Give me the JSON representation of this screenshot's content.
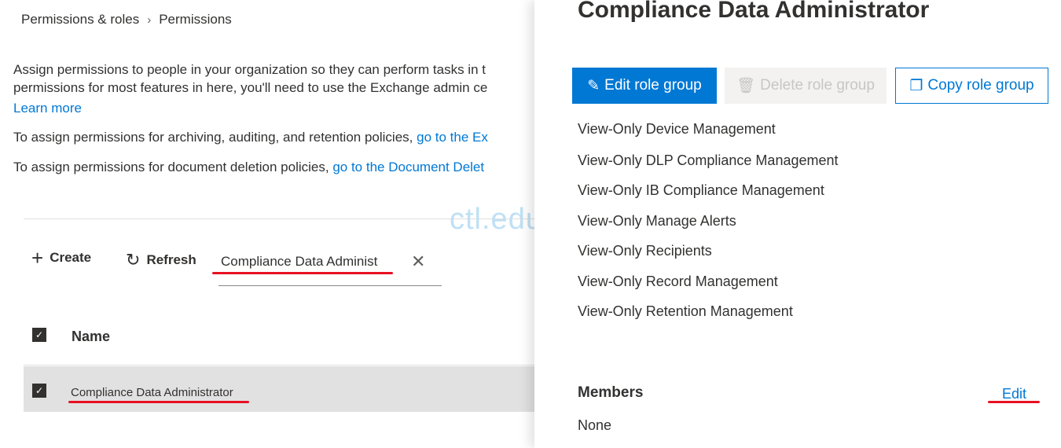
{
  "breadcrumb": [
    "Permissions & roles",
    "Permissions"
  ],
  "intro": {
    "line1": "Assign permissions to people in your organization so they can perform tasks in t",
    "line2": "permissions for most features in here, you'll need to use the Exchange admin ce",
    "learn_more": "Learn more",
    "archiving_text": "To assign permissions for archiving, auditing, and retention policies, ",
    "archiving_link": "go to the Ex",
    "deletion_text": "To assign permissions for document deletion policies, ",
    "deletion_link": "go to the Document Delet"
  },
  "toolbar": {
    "create": "Create",
    "refresh": "Refresh",
    "search_value": "Compliance Data Administ"
  },
  "table": {
    "header": "Name",
    "rows": [
      {
        "name": "Compliance Data Administrator",
        "checked": true
      }
    ]
  },
  "panel": {
    "title": "Compliance Data Administrator",
    "edit_btn": "Edit role group",
    "delete_btn": "Delete role group",
    "copy_btn": "Copy role group",
    "roles": [
      "View-Only Device Management",
      "View-Only DLP Compliance Management",
      "View-Only IB Compliance Management",
      "View-Only Manage Alerts",
      "View-Only Recipients",
      "View-Only Record Management",
      "View-Only Retention Management"
    ],
    "members_label": "Members",
    "members_edit": "Edit",
    "members_value": "None"
  },
  "watermark": "ctl.edu.vn",
  "colors": {
    "accent": "#0078d4",
    "highlight": "#e81123"
  }
}
